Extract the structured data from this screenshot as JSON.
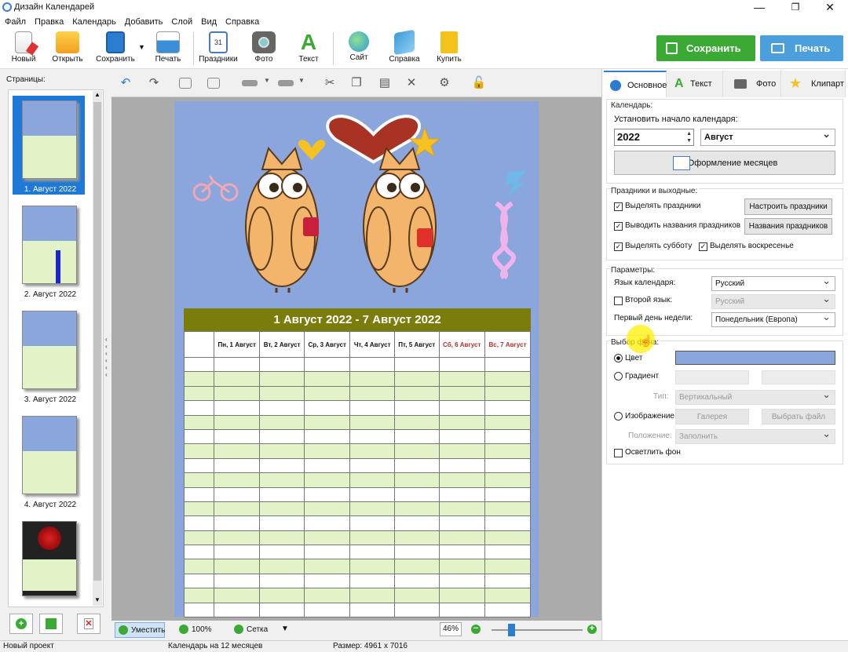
{
  "window": {
    "title": "Дизайн Календарей"
  },
  "menu": [
    "Файл",
    "Правка",
    "Календарь",
    "Добавить",
    "Слой",
    "Вид",
    "Справка"
  ],
  "toolbar": {
    "new": "Новый",
    "open": "Открыть",
    "save": "Сохранить",
    "print": "Печать",
    "holidays": "Праздники",
    "photo": "Фото",
    "text": "Текст",
    "site": "Сайт",
    "help": "Справка",
    "buy": "Купить",
    "save_big": "Сохранить",
    "print_big": "Печать",
    "accent_green": "#3aaa35",
    "accent_blue": "#4a9fdc"
  },
  "left": {
    "title": "Страницы:",
    "pages": [
      "1. Август 2022",
      "2. Август 2022",
      "3. Август 2022",
      "4. Август 2022"
    ]
  },
  "calendar": {
    "title": "1 Август 2022 - 7 Август 2022",
    "days": [
      "Пн, 1 Август",
      "Вт, 2 Август",
      "Ср, 3 Август",
      "Чт, 4 Август",
      "Пт, 5 Август",
      "Сб, 6 Август",
      "Вс, 7 Август"
    ],
    "header_color": "#7a7c0c",
    "bg_color": "#8aa6dc",
    "stripe_color": "#e2f3c7"
  },
  "tabs": [
    "Основное",
    "Текст",
    "Фото",
    "Клипарт"
  ],
  "calendar_group": {
    "label": "Календарь:",
    "start_label": "Установить начало календаря:",
    "year": "2022",
    "month": "Август",
    "months_design": "Оформление месяцев"
  },
  "holidays_group": {
    "label": "Праздники и выходные:",
    "mark_holidays": "Выделять праздники",
    "show_names": "Выводить названия праздников",
    "mark_sat": "Выделять субботу",
    "mark_sun": "Выделять воскресенье",
    "configure": "Настроить праздники",
    "names": "Названия праздников"
  },
  "params_group": {
    "label": "Параметры:",
    "lang_label": "Язык календаря:",
    "lang_value": "Русский",
    "second_lang": "Второй язык:",
    "second_value": "Русский",
    "first_day": "Первый день недели:",
    "first_day_value": "Понедельник (Европа)"
  },
  "bg_group": {
    "label": "Выбор фона:",
    "color": "Цвет",
    "gradient": "Градиент",
    "type_label": "Тип:",
    "type_value": "Вертикальный",
    "image": "Изображение",
    "gallery": "Галерея",
    "choose_file": "Выбрать файл",
    "position_label": "Положение:",
    "position_value": "Заполнить",
    "lighten": "Осветлить фон",
    "swatch": "#8aa6dc"
  },
  "bottom": {
    "fit": "Уместить",
    "zoom100": "100%",
    "grid": "Сетка",
    "zoom": "46%",
    "zoom_level": 0.46
  },
  "status": {
    "project": "Новый проект",
    "type": "Календарь на 12 месяцев",
    "size": "Размер: 4961 x 7016"
  }
}
